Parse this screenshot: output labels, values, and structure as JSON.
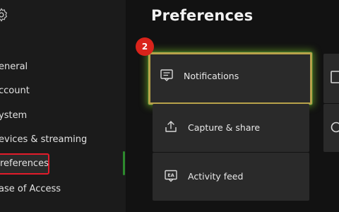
{
  "sidebar": {
    "items": [
      {
        "label": "eneral"
      },
      {
        "label": "ccount"
      },
      {
        "label": "ystem"
      },
      {
        "label": "evices & streaming"
      },
      {
        "label": "references"
      },
      {
        "label": "ase of Access"
      }
    ],
    "selected_index": 4
  },
  "main": {
    "title": "Preferences",
    "step_badge": "2",
    "tiles": [
      {
        "label": "Notifications",
        "icon": "notifications-icon"
      },
      {
        "label": "Capture & share",
        "icon": "upload-icon"
      },
      {
        "label": "Activity feed",
        "icon": "activity-feed-icon"
      }
    ]
  },
  "colors": {
    "accent_green": "#2d8a2d",
    "highlight_red": "#e21b2a",
    "focus_gold": "#b7a24a",
    "badge_red": "#d9231b"
  }
}
